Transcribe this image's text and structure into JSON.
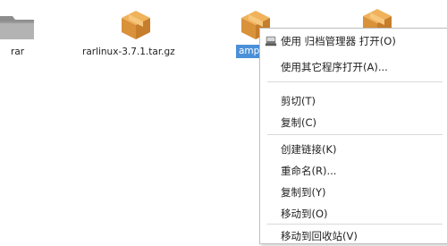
{
  "files": [
    {
      "name": "rar",
      "icon": "folder-icon"
    },
    {
      "name": "rarlinux-3.7.1.tar.gz",
      "icon": "archive-package-icon"
    },
    {
      "name": "amp",
      "icon": "archive-package-icon",
      "selected": true
    },
    {
      "name": "",
      "icon": "archive-package-icon"
    }
  ],
  "context_menu": {
    "items": [
      {
        "label": "使用 归档管理器 打开(O)",
        "icon": "archive-manager-icon"
      },
      {
        "label": "使用其它程序打开(A)..."
      },
      {
        "label": "剪切(T)"
      },
      {
        "label": "复制(C)"
      },
      {
        "label": "创建链接(K)"
      },
      {
        "label": "重命名(R)..."
      },
      {
        "label": "复制到(Y)"
      },
      {
        "label": "移动到(O)"
      },
      {
        "label": "移动到回收站(V)"
      }
    ]
  },
  "colors": {
    "selection": "#4a90d9",
    "package_orange": "#e8a04a"
  }
}
